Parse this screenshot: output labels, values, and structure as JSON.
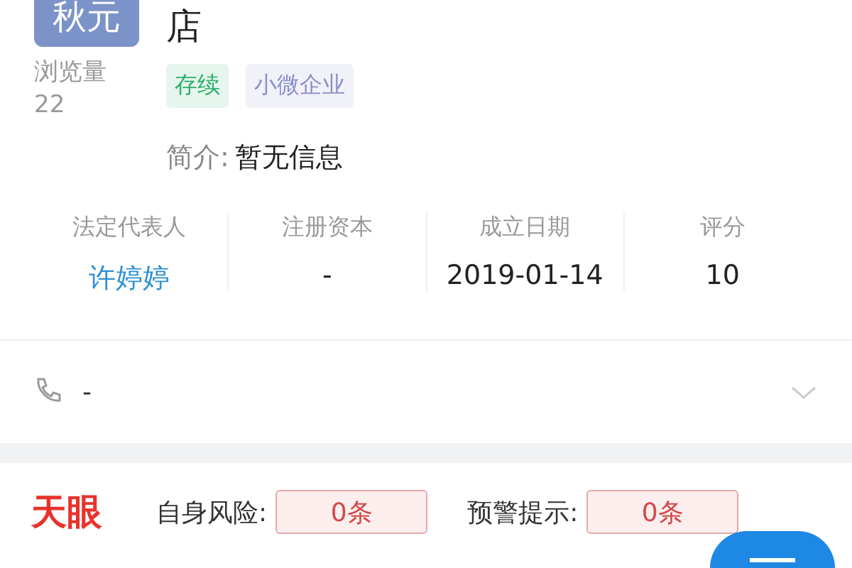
{
  "company": {
    "avatar_text": "秋元",
    "title": "店",
    "views_label": "浏览量",
    "views": "22",
    "tags": [
      {
        "label": "存续",
        "color": "#2fae6a"
      },
      {
        "label": "小微企业",
        "color": "#8a8fc8"
      }
    ],
    "intro_label": "简介:",
    "intro": "暂无信息"
  },
  "stats": [
    {
      "label": "法定代表人",
      "value": "许婷婷",
      "kind": "link"
    },
    {
      "label": "注册资本",
      "value": "-",
      "kind": "plain"
    },
    {
      "label": "成立日期",
      "value": "2019-01-14",
      "kind": "plain"
    },
    {
      "label": "评分",
      "value": "10",
      "kind": "plain"
    }
  ],
  "phone": {
    "value": "-",
    "expanded": false
  },
  "risk": {
    "logo": "天眼",
    "items": [
      {
        "label": "自身风险:",
        "value": "0条"
      },
      {
        "label": "预警提示:",
        "value": "0条"
      }
    ]
  }
}
